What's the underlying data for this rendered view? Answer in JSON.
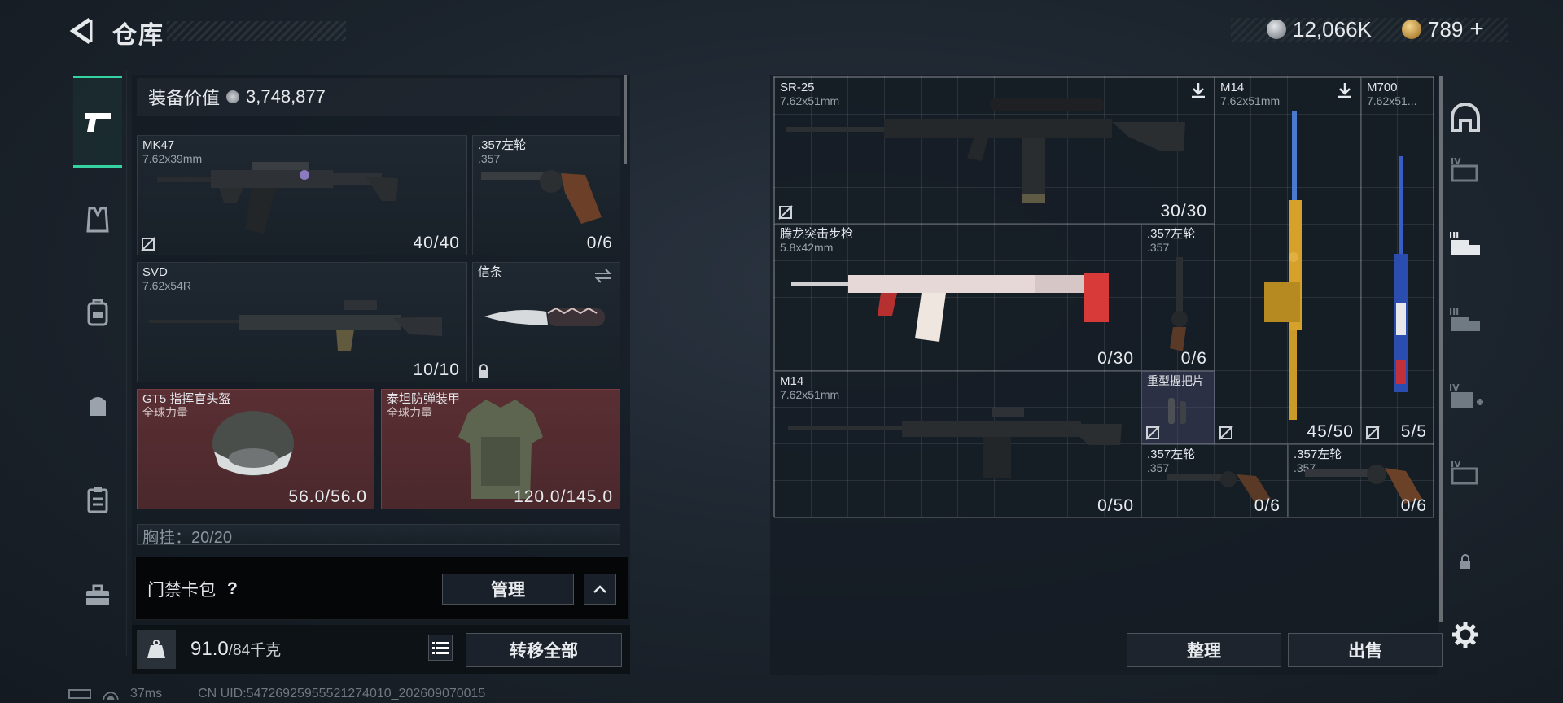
{
  "header": {
    "title": "仓库",
    "currency_1": "12,066K",
    "currency_2": "789",
    "currency_2_add": "+"
  },
  "left_nav": [
    "pistol-icon",
    "vest-icon",
    "backpack-icon",
    "bag-icon",
    "clipboard-icon",
    "toolbox-icon"
  ],
  "equip": {
    "label": "装备价值",
    "value": "3,748,877"
  },
  "loadout": [
    {
      "name": "MK47",
      "caliber": "7.62x39mm",
      "count": "40/40"
    },
    {
      "name": ".357左轮",
      "caliber": ".357",
      "count": "0/6"
    },
    {
      "name": "SVD",
      "caliber": "7.62x54R",
      "count": "10/10"
    },
    {
      "name": "信条",
      "caliber": "",
      "count": ""
    },
    {
      "name": "GT5 指挥官头盔",
      "caliber": "全球力量",
      "count": "56.0/56.0"
    },
    {
      "name": "泰坦防弹装甲",
      "caliber": "全球力量",
      "count": "120.0/145.0"
    }
  ],
  "chest_rig": "胸挂：20/20",
  "keycard": {
    "label": "门禁卡包",
    "help": "?",
    "manage": "管理"
  },
  "bottom": {
    "weight": "91.0",
    "capacity": "/84千克",
    "transfer": "转移全部"
  },
  "status": {
    "ping": "37ms",
    "uid": "CN UID:54726925955521274010_202609070015"
  },
  "stash": [
    {
      "name": "SR-25",
      "caliber": "7.62x51mm",
      "count": "30/30"
    },
    {
      "name": "M14",
      "caliber": "7.62x51mm",
      "count": "45/50"
    },
    {
      "name": "M700",
      "caliber": "7.62x51...",
      "count": "5/5"
    },
    {
      "name": "腾龙突击步枪",
      "caliber": "5.8x42mm",
      "count": "0/30"
    },
    {
      "name": ".357左轮",
      "caliber": ".357",
      "count": "0/6"
    },
    {
      "name": "M14",
      "caliber": "7.62x51mm",
      "count": "0/50"
    },
    {
      "name": "重型握把片",
      "caliber": "",
      "count": ""
    },
    {
      "name": ".357左轮",
      "caliber": ".357",
      "count": "0/6"
    },
    {
      "name": ".357左轮",
      "caliber": ".357",
      "count": "0/6"
    }
  ],
  "actions": {
    "sort": "整理",
    "sell": "出售"
  },
  "right_nav": {
    "tiers": [
      "IV",
      "III",
      "III",
      "IV",
      "IV"
    ]
  }
}
